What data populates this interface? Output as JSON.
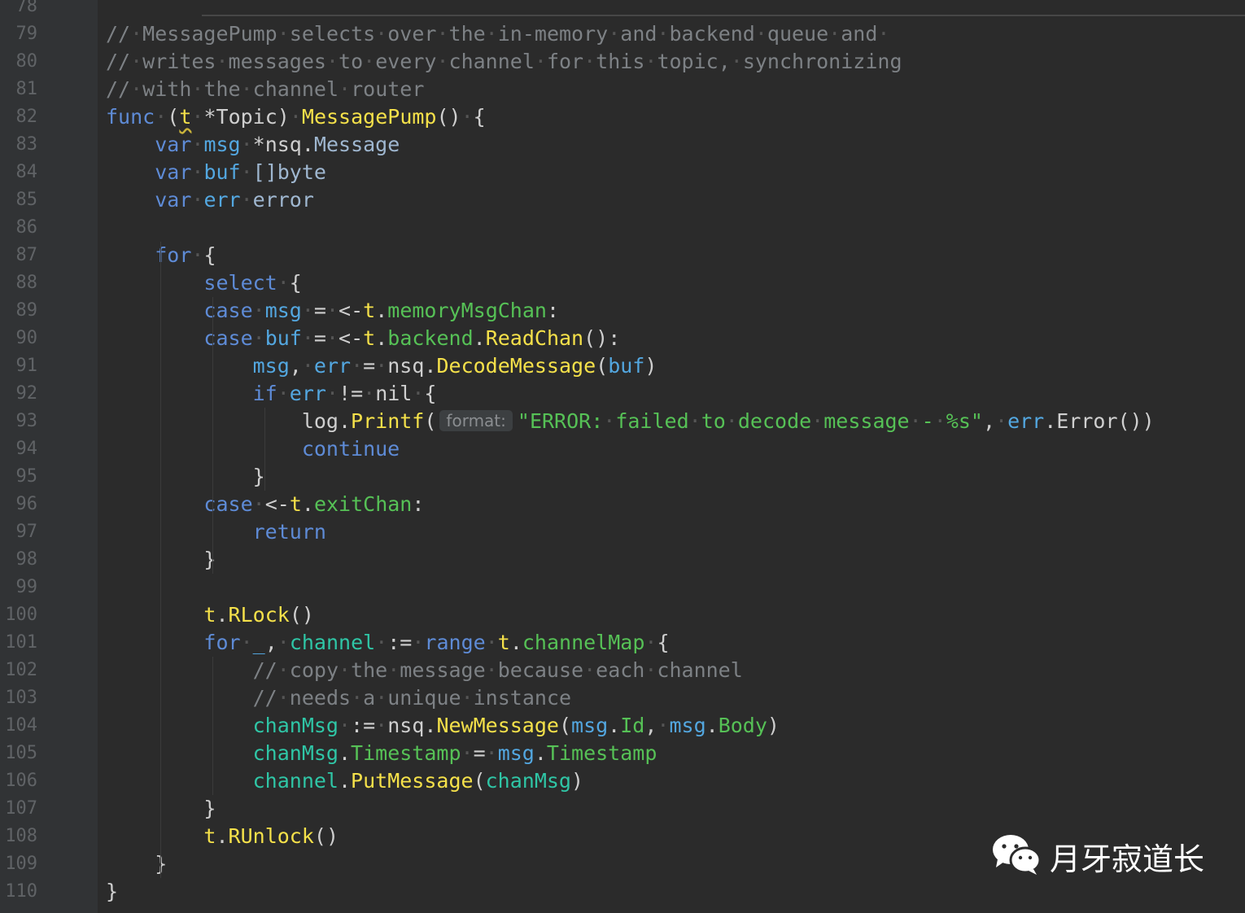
{
  "editor": {
    "language": "go",
    "colors": {
      "background": "#2b2b2b",
      "gutter": "#313335",
      "comment": "#7d8185",
      "keyword": "#5e8bd6",
      "function": "#f5e14a",
      "field": "#56c156",
      "string": "#56c156",
      "variable": "#2fc6a6"
    },
    "line_numbers": [
      "78",
      "79",
      "80",
      "81",
      "82",
      "83",
      "84",
      "85",
      "86",
      "87",
      "88",
      "89",
      "90",
      "91",
      "92",
      "93",
      "94",
      "95",
      "96",
      "97",
      "98",
      "99",
      "100",
      "101",
      "102",
      "103",
      "104",
      "105",
      "106",
      "107",
      "108",
      "109",
      "110"
    ],
    "inlay_hint": "format:",
    "lines": [
      [],
      [
        {
          "t": "//",
          "c": "cm"
        },
        {
          "t": "·",
          "c": "dot"
        },
        {
          "t": "MessagePump",
          "c": "cm"
        },
        {
          "t": "·",
          "c": "dot"
        },
        {
          "t": "selects",
          "c": "cm"
        },
        {
          "t": "·",
          "c": "dot"
        },
        {
          "t": "over",
          "c": "cm"
        },
        {
          "t": "·",
          "c": "dot"
        },
        {
          "t": "the",
          "c": "cm"
        },
        {
          "t": "·",
          "c": "dot"
        },
        {
          "t": "in-memory",
          "c": "cm"
        },
        {
          "t": "·",
          "c": "dot"
        },
        {
          "t": "and",
          "c": "cm"
        },
        {
          "t": "·",
          "c": "dot"
        },
        {
          "t": "backend",
          "c": "cm"
        },
        {
          "t": "·",
          "c": "dot"
        },
        {
          "t": "queue",
          "c": "cm"
        },
        {
          "t": "·",
          "c": "dot"
        },
        {
          "t": "and",
          "c": "cm"
        },
        {
          "t": "·",
          "c": "dot"
        }
      ],
      [
        {
          "t": "//",
          "c": "cm"
        },
        {
          "t": "·",
          "c": "dot"
        },
        {
          "t": "writes",
          "c": "cm"
        },
        {
          "t": "·",
          "c": "dot"
        },
        {
          "t": "messages",
          "c": "cm"
        },
        {
          "t": "·",
          "c": "dot"
        },
        {
          "t": "to",
          "c": "cm"
        },
        {
          "t": "·",
          "c": "dot"
        },
        {
          "t": "every",
          "c": "cm"
        },
        {
          "t": "·",
          "c": "dot"
        },
        {
          "t": "channel",
          "c": "cm"
        },
        {
          "t": "·",
          "c": "dot"
        },
        {
          "t": "for",
          "c": "cm"
        },
        {
          "t": "·",
          "c": "dot"
        },
        {
          "t": "this",
          "c": "cm"
        },
        {
          "t": "·",
          "c": "dot"
        },
        {
          "t": "topic,",
          "c": "cm"
        },
        {
          "t": "·",
          "c": "dot"
        },
        {
          "t": "synchronizing",
          "c": "cm"
        }
      ],
      [
        {
          "t": "//",
          "c": "cm"
        },
        {
          "t": "·",
          "c": "dot"
        },
        {
          "t": "with",
          "c": "cm"
        },
        {
          "t": "·",
          "c": "dot"
        },
        {
          "t": "the",
          "c": "cm"
        },
        {
          "t": "·",
          "c": "dot"
        },
        {
          "t": "channel",
          "c": "cm"
        },
        {
          "t": "·",
          "c": "dot"
        },
        {
          "t": "router",
          "c": "cm"
        }
      ],
      [
        {
          "t": "func",
          "c": "kw"
        },
        {
          "t": "·",
          "c": "dot"
        },
        {
          "t": "(",
          "c": "pun"
        },
        {
          "t": "t",
          "c": "rc warn"
        },
        {
          "t": "·",
          "c": "dot"
        },
        {
          "t": "*Topic",
          "c": "id"
        },
        {
          "t": ")",
          "c": "pun"
        },
        {
          "t": "·",
          "c": "dot"
        },
        {
          "t": "MessagePump",
          "c": "fn"
        },
        {
          "t": "()",
          "c": "pun"
        },
        {
          "t": "·",
          "c": "dot"
        },
        {
          "t": "{",
          "c": "pun"
        }
      ],
      [
        {
          "t": "    ",
          "c": "pun"
        },
        {
          "t": "var",
          "c": "kw"
        },
        {
          "t": "·",
          "c": "dot"
        },
        {
          "t": "msg",
          "c": "loc"
        },
        {
          "t": "·",
          "c": "dot"
        },
        {
          "t": "*nsq.",
          "c": "id"
        },
        {
          "t": "Message",
          "c": "ty"
        }
      ],
      [
        {
          "t": "    ",
          "c": "pun"
        },
        {
          "t": "var",
          "c": "kw"
        },
        {
          "t": "·",
          "c": "dot"
        },
        {
          "t": "buf",
          "c": "loc"
        },
        {
          "t": "·",
          "c": "dot"
        },
        {
          "t": "[]byte",
          "c": "ty"
        }
      ],
      [
        {
          "t": "    ",
          "c": "pun"
        },
        {
          "t": "var",
          "c": "kw"
        },
        {
          "t": "·",
          "c": "dot"
        },
        {
          "t": "err",
          "c": "loc"
        },
        {
          "t": "·",
          "c": "dot"
        },
        {
          "t": "error",
          "c": "ty"
        }
      ],
      [],
      [
        {
          "t": "    ",
          "c": "pun"
        },
        {
          "t": "for",
          "c": "kw"
        },
        {
          "t": "·",
          "c": "dot"
        },
        {
          "t": "{",
          "c": "pun"
        }
      ],
      [
        {
          "t": "        ",
          "c": "pun"
        },
        {
          "t": "select",
          "c": "kw"
        },
        {
          "t": "·",
          "c": "dot"
        },
        {
          "t": "{",
          "c": "pun"
        }
      ],
      [
        {
          "t": "        ",
          "c": "pun"
        },
        {
          "t": "case",
          "c": "kw"
        },
        {
          "t": "·",
          "c": "dot"
        },
        {
          "t": "msg",
          "c": "loc"
        },
        {
          "t": "·",
          "c": "dot"
        },
        {
          "t": "=",
          "c": "pun"
        },
        {
          "t": "·",
          "c": "dot"
        },
        {
          "t": "<-",
          "c": "pun"
        },
        {
          "t": "t",
          "c": "rc"
        },
        {
          "t": ".",
          "c": "pun"
        },
        {
          "t": "memoryMsgChan",
          "c": "fld"
        },
        {
          "t": ":",
          "c": "pun"
        }
      ],
      [
        {
          "t": "        ",
          "c": "pun"
        },
        {
          "t": "case",
          "c": "kw"
        },
        {
          "t": "·",
          "c": "dot"
        },
        {
          "t": "buf",
          "c": "loc"
        },
        {
          "t": "·",
          "c": "dot"
        },
        {
          "t": "=",
          "c": "pun"
        },
        {
          "t": "·",
          "c": "dot"
        },
        {
          "t": "<-",
          "c": "pun"
        },
        {
          "t": "t",
          "c": "rc"
        },
        {
          "t": ".",
          "c": "pun"
        },
        {
          "t": "backend",
          "c": "fld"
        },
        {
          "t": ".",
          "c": "pun"
        },
        {
          "t": "ReadChan",
          "c": "fn"
        },
        {
          "t": "():",
          "c": "pun"
        }
      ],
      [
        {
          "t": "            ",
          "c": "pun"
        },
        {
          "t": "msg",
          "c": "loc"
        },
        {
          "t": ",",
          "c": "pun"
        },
        {
          "t": "·",
          "c": "dot"
        },
        {
          "t": "err",
          "c": "loc"
        },
        {
          "t": "·",
          "c": "dot"
        },
        {
          "t": "=",
          "c": "pun"
        },
        {
          "t": "·",
          "c": "dot"
        },
        {
          "t": "nsq.",
          "c": "id"
        },
        {
          "t": "DecodeMessage",
          "c": "fn"
        },
        {
          "t": "(",
          "c": "pun"
        },
        {
          "t": "buf",
          "c": "loc"
        },
        {
          "t": ")",
          "c": "pun"
        }
      ],
      [
        {
          "t": "            ",
          "c": "pun"
        },
        {
          "t": "if",
          "c": "kw"
        },
        {
          "t": "·",
          "c": "dot"
        },
        {
          "t": "err",
          "c": "loc"
        },
        {
          "t": "·",
          "c": "dot"
        },
        {
          "t": "!=",
          "c": "pun"
        },
        {
          "t": "·",
          "c": "dot"
        },
        {
          "t": "nil",
          "c": "id"
        },
        {
          "t": "·",
          "c": "dot"
        },
        {
          "t": "{",
          "c": "pun"
        }
      ],
      [
        {
          "t": "                ",
          "c": "pun"
        },
        {
          "t": "log.",
          "c": "id"
        },
        {
          "t": "Printf",
          "c": "fn"
        },
        {
          "t": "(",
          "c": "pun"
        },
        {
          "hint": true
        },
        {
          "t": "\"ERROR:",
          "c": "str"
        },
        {
          "t": "·",
          "c": "dot"
        },
        {
          "t": "failed",
          "c": "str"
        },
        {
          "t": "·",
          "c": "dot"
        },
        {
          "t": "to",
          "c": "str"
        },
        {
          "t": "·",
          "c": "dot"
        },
        {
          "t": "decode",
          "c": "str"
        },
        {
          "t": "·",
          "c": "dot"
        },
        {
          "t": "message",
          "c": "str"
        },
        {
          "t": "·",
          "c": "dot"
        },
        {
          "t": "-",
          "c": "str"
        },
        {
          "t": "·",
          "c": "dot"
        },
        {
          "t": "%s\"",
          "c": "str"
        },
        {
          "t": ",",
          "c": "pun"
        },
        {
          "t": "·",
          "c": "dot"
        },
        {
          "t": "err",
          "c": "loc"
        },
        {
          "t": ".Error())",
          "c": "pun"
        }
      ],
      [
        {
          "t": "                ",
          "c": "pun"
        },
        {
          "t": "continue",
          "c": "kw"
        }
      ],
      [
        {
          "t": "            ",
          "c": "pun"
        },
        {
          "t": "}",
          "c": "pun"
        }
      ],
      [
        {
          "t": "        ",
          "c": "pun"
        },
        {
          "t": "case",
          "c": "kw"
        },
        {
          "t": "·",
          "c": "dot"
        },
        {
          "t": "<-",
          "c": "pun"
        },
        {
          "t": "t",
          "c": "rc"
        },
        {
          "t": ".",
          "c": "pun"
        },
        {
          "t": "exitChan",
          "c": "fld"
        },
        {
          "t": ":",
          "c": "pun"
        }
      ],
      [
        {
          "t": "            ",
          "c": "pun"
        },
        {
          "t": "return",
          "c": "kw"
        }
      ],
      [
        {
          "t": "        ",
          "c": "pun"
        },
        {
          "t": "}",
          "c": "pun"
        }
      ],
      [],
      [
        {
          "t": "        ",
          "c": "pun"
        },
        {
          "t": "t",
          "c": "rc"
        },
        {
          "t": ".",
          "c": "pun"
        },
        {
          "t": "RLock",
          "c": "fn"
        },
        {
          "t": "()",
          "c": "pun"
        }
      ],
      [
        {
          "t": "        ",
          "c": "pun"
        },
        {
          "t": "for",
          "c": "kw"
        },
        {
          "t": "·",
          "c": "dot"
        },
        {
          "t": "_",
          "c": "loc"
        },
        {
          "t": ",",
          "c": "pun"
        },
        {
          "t": "·",
          "c": "dot"
        },
        {
          "t": "channel",
          "c": "var"
        },
        {
          "t": "·",
          "c": "dot"
        },
        {
          "t": ":=",
          "c": "pun"
        },
        {
          "t": "·",
          "c": "dot"
        },
        {
          "t": "range",
          "c": "kw"
        },
        {
          "t": "·",
          "c": "dot"
        },
        {
          "t": "t",
          "c": "rc"
        },
        {
          "t": ".",
          "c": "pun"
        },
        {
          "t": "channelMap",
          "c": "fld"
        },
        {
          "t": "·",
          "c": "dot"
        },
        {
          "t": "{",
          "c": "pun"
        }
      ],
      [
        {
          "t": "            ",
          "c": "pun"
        },
        {
          "t": "//",
          "c": "cm"
        },
        {
          "t": "·",
          "c": "dot"
        },
        {
          "t": "copy",
          "c": "cm"
        },
        {
          "t": "·",
          "c": "dot"
        },
        {
          "t": "the",
          "c": "cm"
        },
        {
          "t": "·",
          "c": "dot"
        },
        {
          "t": "message",
          "c": "cm"
        },
        {
          "t": "·",
          "c": "dot"
        },
        {
          "t": "because",
          "c": "cm"
        },
        {
          "t": "·",
          "c": "dot"
        },
        {
          "t": "each",
          "c": "cm"
        },
        {
          "t": "·",
          "c": "dot"
        },
        {
          "t": "channel",
          "c": "cm"
        }
      ],
      [
        {
          "t": "            ",
          "c": "pun"
        },
        {
          "t": "//",
          "c": "cm"
        },
        {
          "t": "·",
          "c": "dot"
        },
        {
          "t": "needs",
          "c": "cm"
        },
        {
          "t": "·",
          "c": "dot"
        },
        {
          "t": "a",
          "c": "cm"
        },
        {
          "t": "·",
          "c": "dot"
        },
        {
          "t": "unique",
          "c": "cm"
        },
        {
          "t": "·",
          "c": "dot"
        },
        {
          "t": "instance",
          "c": "cm"
        }
      ],
      [
        {
          "t": "            ",
          "c": "pun"
        },
        {
          "t": "chanMsg",
          "c": "var"
        },
        {
          "t": "·",
          "c": "dot"
        },
        {
          "t": ":=",
          "c": "pun"
        },
        {
          "t": "·",
          "c": "dot"
        },
        {
          "t": "nsq.",
          "c": "id"
        },
        {
          "t": "NewMessage",
          "c": "fn"
        },
        {
          "t": "(",
          "c": "pun"
        },
        {
          "t": "msg",
          "c": "loc"
        },
        {
          "t": ".",
          "c": "pun"
        },
        {
          "t": "Id",
          "c": "fld"
        },
        {
          "t": ",",
          "c": "pun"
        },
        {
          "t": "·",
          "c": "dot"
        },
        {
          "t": "msg",
          "c": "loc"
        },
        {
          "t": ".",
          "c": "pun"
        },
        {
          "t": "Body",
          "c": "fld"
        },
        {
          "t": ")",
          "c": "pun"
        }
      ],
      [
        {
          "t": "            ",
          "c": "pun"
        },
        {
          "t": "chanMsg",
          "c": "var"
        },
        {
          "t": ".",
          "c": "pun"
        },
        {
          "t": "Timestamp",
          "c": "fld"
        },
        {
          "t": "·",
          "c": "dot"
        },
        {
          "t": "=",
          "c": "pun"
        },
        {
          "t": "·",
          "c": "dot"
        },
        {
          "t": "msg",
          "c": "loc"
        },
        {
          "t": ".",
          "c": "pun"
        },
        {
          "t": "Timestamp",
          "c": "fld"
        }
      ],
      [
        {
          "t": "            ",
          "c": "pun"
        },
        {
          "t": "channel",
          "c": "var"
        },
        {
          "t": ".",
          "c": "pun"
        },
        {
          "t": "PutMessage",
          "c": "fn"
        },
        {
          "t": "(",
          "c": "pun"
        },
        {
          "t": "chanMsg",
          "c": "var"
        },
        {
          "t": ")",
          "c": "pun"
        }
      ],
      [
        {
          "t": "        ",
          "c": "pun"
        },
        {
          "t": "}",
          "c": "pun"
        }
      ],
      [
        {
          "t": "        ",
          "c": "pun"
        },
        {
          "t": "t",
          "c": "rc"
        },
        {
          "t": ".",
          "c": "pun"
        },
        {
          "t": "RUnlock",
          "c": "fn"
        },
        {
          "t": "()",
          "c": "pun"
        }
      ],
      [
        {
          "t": "    ",
          "c": "pun"
        },
        {
          "t": "}",
          "c": "pun"
        }
      ],
      [
        {
          "t": "}",
          "c": "pun"
        }
      ]
    ]
  },
  "watermark": {
    "icon": "wechat-icon",
    "text": "月牙寂道长"
  }
}
